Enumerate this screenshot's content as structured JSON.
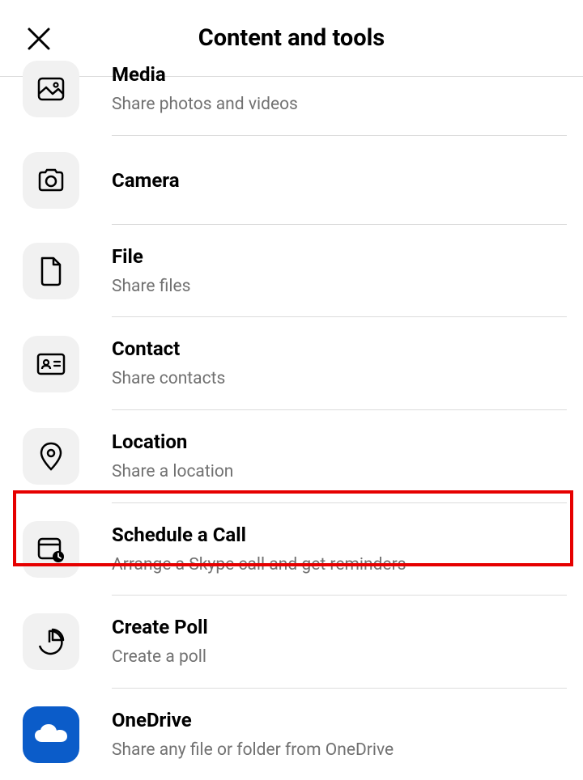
{
  "header": {
    "title": "Content and tools"
  },
  "items": [
    {
      "id": "media",
      "title": "Media",
      "subtitle": "Share photos and videos",
      "icon": "image-icon"
    },
    {
      "id": "camera",
      "title": "Camera",
      "subtitle": "",
      "icon": "camera-icon"
    },
    {
      "id": "file",
      "title": "File",
      "subtitle": "Share files",
      "icon": "file-icon"
    },
    {
      "id": "contact",
      "title": "Contact",
      "subtitle": "Share contacts",
      "icon": "contact-card-icon"
    },
    {
      "id": "location",
      "title": "Location",
      "subtitle": "Share a location",
      "icon": "location-pin-icon"
    },
    {
      "id": "schedule",
      "title": "Schedule a Call",
      "subtitle": "Arrange a Skype call and get reminders",
      "icon": "calendar-clock-icon",
      "highlighted": true
    },
    {
      "id": "poll",
      "title": "Create Poll",
      "subtitle": "Create a poll",
      "icon": "pie-chart-icon"
    },
    {
      "id": "onedrive",
      "title": "OneDrive",
      "subtitle": "Share any file or folder from OneDrive",
      "icon": "onedrive-icon"
    }
  ]
}
